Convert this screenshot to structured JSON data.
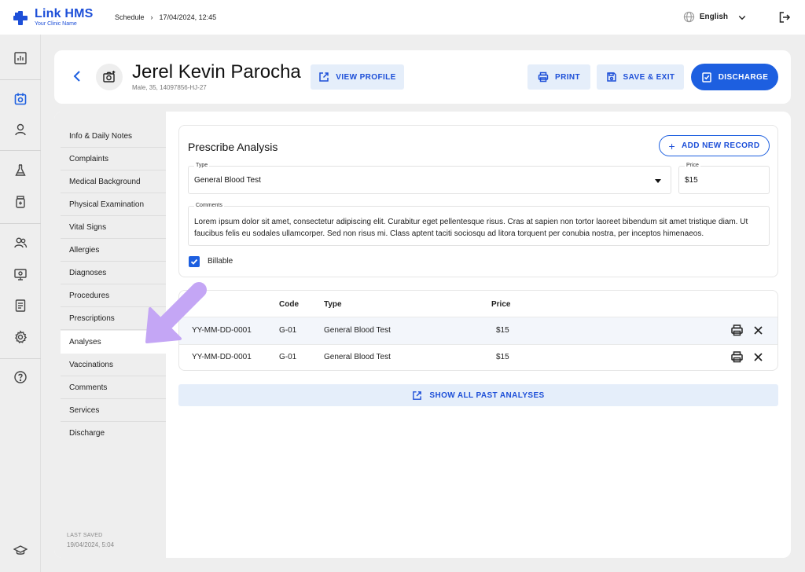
{
  "app": {
    "name": "Link HMS",
    "tagline": "Your Clinic Name"
  },
  "breadcrumb": {
    "section": "Schedule",
    "separator": "›",
    "datetime": "17/04/2024, 12:45"
  },
  "header_right": {
    "language": "English"
  },
  "patient": {
    "name": "Jerel Kevin Parocha",
    "meta": "Male, 35, 14097856-HJ-27"
  },
  "actions": {
    "view_profile": "VIEW PROFILE",
    "print": "PRINT",
    "save_exit": "SAVE & EXIT",
    "discharge": "DISCHARGE"
  },
  "nav": {
    "items": [
      "Info & Daily Notes",
      "Complaints",
      "Medical Background",
      "Physical Examination",
      "Vital Signs",
      "Allergies",
      "Diagnoses",
      "Procedures",
      "Prescriptions",
      "Analyses",
      "Vaccinations",
      "Comments",
      "Services",
      "Discharge"
    ],
    "active": "Analyses",
    "last_saved_label": "LAST SAVED",
    "last_saved_value": "19/04/2024, 5:04"
  },
  "prescribe": {
    "title": "Prescribe Analysis",
    "add_button": "ADD NEW RECORD",
    "type_label": "Type",
    "type_value": "General Blood Test",
    "price_label": "Price",
    "price_value": "$15",
    "comments_label": "Comments",
    "comments_value": "Lorem ipsum dolor sit amet, consectetur adipiscing elit. Curabitur eget pellentesque risus. Cras at sapien non tortor laoreet bibendum sit amet tristique diam. Ut faucibus felis eu sodales ullamcorper. Sed non risus mi. Class aptent taciti sociosqu ad litora torquent per conubia nostra, per inceptos himenaeos.",
    "billable_label": "Billable",
    "billable_checked": true
  },
  "table": {
    "headers": {
      "code": "Code",
      "type": "Type",
      "price": "Price"
    },
    "rows": [
      {
        "id": "YY-MM-DD-0001",
        "code": "G-01",
        "type": "General Blood Test",
        "price": "$15"
      },
      {
        "id": "YY-MM-DD-0001",
        "code": "G-01",
        "type": "General Blood Test",
        "price": "$15"
      }
    ]
  },
  "show_all": "SHOW ALL PAST ANALYSES",
  "colors": {
    "primary": "#1d5fe0",
    "primary_light": "#e5eefa",
    "pointer": "#c4a6f5"
  }
}
